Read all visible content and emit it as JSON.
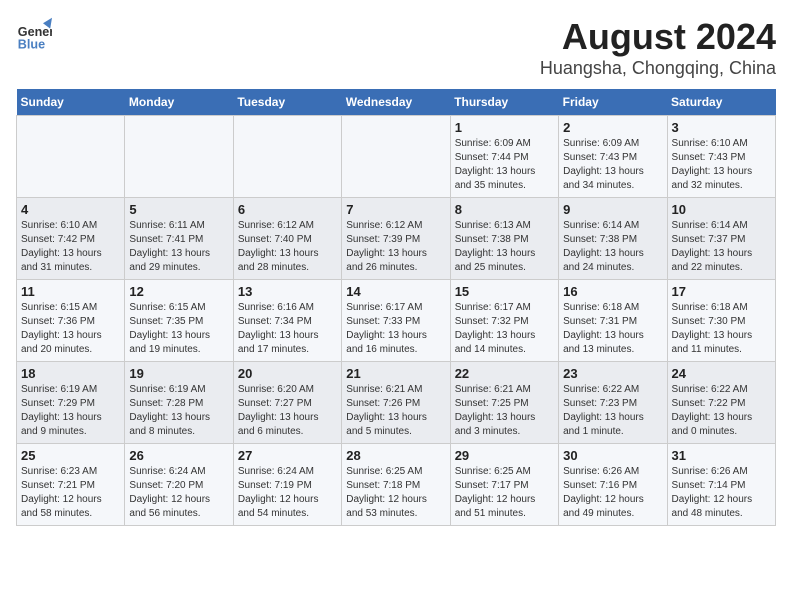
{
  "header": {
    "logo_line1": "General",
    "logo_line2": "Blue",
    "title": "August 2024",
    "subtitle": "Huangsha, Chongqing, China"
  },
  "weekdays": [
    "Sunday",
    "Monday",
    "Tuesday",
    "Wednesday",
    "Thursday",
    "Friday",
    "Saturday"
  ],
  "weeks": [
    [
      {
        "day": "",
        "info": ""
      },
      {
        "day": "",
        "info": ""
      },
      {
        "day": "",
        "info": ""
      },
      {
        "day": "",
        "info": ""
      },
      {
        "day": "1",
        "info": "Sunrise: 6:09 AM\nSunset: 7:44 PM\nDaylight: 13 hours\nand 35 minutes."
      },
      {
        "day": "2",
        "info": "Sunrise: 6:09 AM\nSunset: 7:43 PM\nDaylight: 13 hours\nand 34 minutes."
      },
      {
        "day": "3",
        "info": "Sunrise: 6:10 AM\nSunset: 7:43 PM\nDaylight: 13 hours\nand 32 minutes."
      }
    ],
    [
      {
        "day": "4",
        "info": "Sunrise: 6:10 AM\nSunset: 7:42 PM\nDaylight: 13 hours\nand 31 minutes."
      },
      {
        "day": "5",
        "info": "Sunrise: 6:11 AM\nSunset: 7:41 PM\nDaylight: 13 hours\nand 29 minutes."
      },
      {
        "day": "6",
        "info": "Sunrise: 6:12 AM\nSunset: 7:40 PM\nDaylight: 13 hours\nand 28 minutes."
      },
      {
        "day": "7",
        "info": "Sunrise: 6:12 AM\nSunset: 7:39 PM\nDaylight: 13 hours\nand 26 minutes."
      },
      {
        "day": "8",
        "info": "Sunrise: 6:13 AM\nSunset: 7:38 PM\nDaylight: 13 hours\nand 25 minutes."
      },
      {
        "day": "9",
        "info": "Sunrise: 6:14 AM\nSunset: 7:38 PM\nDaylight: 13 hours\nand 24 minutes."
      },
      {
        "day": "10",
        "info": "Sunrise: 6:14 AM\nSunset: 7:37 PM\nDaylight: 13 hours\nand 22 minutes."
      }
    ],
    [
      {
        "day": "11",
        "info": "Sunrise: 6:15 AM\nSunset: 7:36 PM\nDaylight: 13 hours\nand 20 minutes."
      },
      {
        "day": "12",
        "info": "Sunrise: 6:15 AM\nSunset: 7:35 PM\nDaylight: 13 hours\nand 19 minutes."
      },
      {
        "day": "13",
        "info": "Sunrise: 6:16 AM\nSunset: 7:34 PM\nDaylight: 13 hours\nand 17 minutes."
      },
      {
        "day": "14",
        "info": "Sunrise: 6:17 AM\nSunset: 7:33 PM\nDaylight: 13 hours\nand 16 minutes."
      },
      {
        "day": "15",
        "info": "Sunrise: 6:17 AM\nSunset: 7:32 PM\nDaylight: 13 hours\nand 14 minutes."
      },
      {
        "day": "16",
        "info": "Sunrise: 6:18 AM\nSunset: 7:31 PM\nDaylight: 13 hours\nand 13 minutes."
      },
      {
        "day": "17",
        "info": "Sunrise: 6:18 AM\nSunset: 7:30 PM\nDaylight: 13 hours\nand 11 minutes."
      }
    ],
    [
      {
        "day": "18",
        "info": "Sunrise: 6:19 AM\nSunset: 7:29 PM\nDaylight: 13 hours\nand 9 minutes."
      },
      {
        "day": "19",
        "info": "Sunrise: 6:19 AM\nSunset: 7:28 PM\nDaylight: 13 hours\nand 8 minutes."
      },
      {
        "day": "20",
        "info": "Sunrise: 6:20 AM\nSunset: 7:27 PM\nDaylight: 13 hours\nand 6 minutes."
      },
      {
        "day": "21",
        "info": "Sunrise: 6:21 AM\nSunset: 7:26 PM\nDaylight: 13 hours\nand 5 minutes."
      },
      {
        "day": "22",
        "info": "Sunrise: 6:21 AM\nSunset: 7:25 PM\nDaylight: 13 hours\nand 3 minutes."
      },
      {
        "day": "23",
        "info": "Sunrise: 6:22 AM\nSunset: 7:23 PM\nDaylight: 13 hours\nand 1 minute."
      },
      {
        "day": "24",
        "info": "Sunrise: 6:22 AM\nSunset: 7:22 PM\nDaylight: 13 hours\nand 0 minutes."
      }
    ],
    [
      {
        "day": "25",
        "info": "Sunrise: 6:23 AM\nSunset: 7:21 PM\nDaylight: 12 hours\nand 58 minutes."
      },
      {
        "day": "26",
        "info": "Sunrise: 6:24 AM\nSunset: 7:20 PM\nDaylight: 12 hours\nand 56 minutes."
      },
      {
        "day": "27",
        "info": "Sunrise: 6:24 AM\nSunset: 7:19 PM\nDaylight: 12 hours\nand 54 minutes."
      },
      {
        "day": "28",
        "info": "Sunrise: 6:25 AM\nSunset: 7:18 PM\nDaylight: 12 hours\nand 53 minutes."
      },
      {
        "day": "29",
        "info": "Sunrise: 6:25 AM\nSunset: 7:17 PM\nDaylight: 12 hours\nand 51 minutes."
      },
      {
        "day": "30",
        "info": "Sunrise: 6:26 AM\nSunset: 7:16 PM\nDaylight: 12 hours\nand 49 minutes."
      },
      {
        "day": "31",
        "info": "Sunrise: 6:26 AM\nSunset: 7:14 PM\nDaylight: 12 hours\nand 48 minutes."
      }
    ]
  ]
}
